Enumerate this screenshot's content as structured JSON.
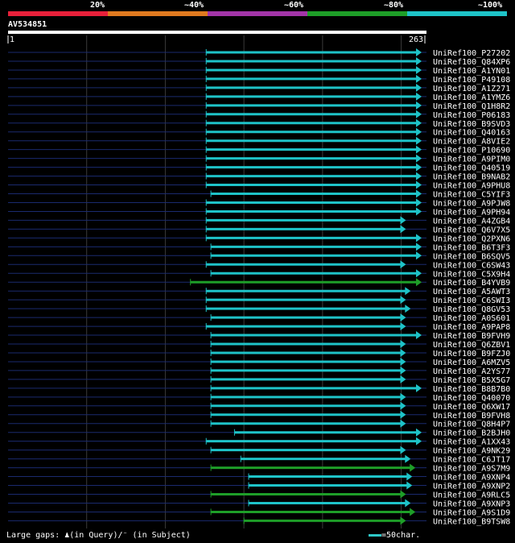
{
  "legend": {
    "colors": [
      "#e8203a",
      "#e07a1f",
      "#a335a8",
      "#1e9e28",
      "#1ec3c8"
    ],
    "labels": [
      "20%",
      "~40%",
      "~60%",
      "~80%",
      "~100%"
    ]
  },
  "query": {
    "id": "AV534851",
    "start_label": "1",
    "end_label": "263"
  },
  "footer": {
    "gaps_text": "Large gaps: ♟(in Query)/⁻ (in Subject)",
    "scale_text": "=50char."
  },
  "chart_data": {
    "type": "alignment",
    "query_length": 263,
    "hits": [
      {
        "name": "UniRef100_P27202",
        "start": 127,
        "end": 263,
        "identity": "~100%"
      },
      {
        "name": "UniRef100_Q84XP6",
        "start": 127,
        "end": 263,
        "identity": "~100%"
      },
      {
        "name": "UniRef100_A1YN01",
        "start": 127,
        "end": 263,
        "identity": "~100%"
      },
      {
        "name": "UniRef100_P49108",
        "start": 127,
        "end": 263,
        "identity": "~100%"
      },
      {
        "name": "UniRef100_A1Z271",
        "start": 127,
        "end": 263,
        "identity": "~100%"
      },
      {
        "name": "UniRef100_A1YMZ6",
        "start": 127,
        "end": 263,
        "identity": "~100%"
      },
      {
        "name": "UniRef100_Q1H8R2",
        "start": 127,
        "end": 263,
        "identity": "~100%"
      },
      {
        "name": "UniRef100_P06183",
        "start": 127,
        "end": 263,
        "identity": "~100%"
      },
      {
        "name": "UniRef100_B9SVD3",
        "start": 127,
        "end": 263,
        "identity": "~100%"
      },
      {
        "name": "UniRef100_Q40163",
        "start": 127,
        "end": 263,
        "identity": "~100%"
      },
      {
        "name": "UniRef100_A8VIE2",
        "start": 127,
        "end": 263,
        "identity": "~100%"
      },
      {
        "name": "UniRef100_P10690",
        "start": 127,
        "end": 263,
        "identity": "~100%"
      },
      {
        "name": "UniRef100_A9PIM0",
        "start": 127,
        "end": 263,
        "identity": "~100%"
      },
      {
        "name": "UniRef100_Q40519",
        "start": 127,
        "end": 263,
        "identity": "~100%"
      },
      {
        "name": "UniRef100_B9NAB2",
        "start": 127,
        "end": 263,
        "identity": "~100%"
      },
      {
        "name": "UniRef100_A9PHU8",
        "start": 127,
        "end": 263,
        "identity": "~100%"
      },
      {
        "name": "UniRef100_C5YIF3",
        "start": 130,
        "end": 263,
        "identity": "~100%"
      },
      {
        "name": "UniRef100_A9PJW8",
        "start": 127,
        "end": 263,
        "identity": "~100%"
      },
      {
        "name": "UniRef100_A9PH94",
        "start": 127,
        "end": 263,
        "identity": "~100%"
      },
      {
        "name": "UniRef100_A4ZGB4",
        "start": 127,
        "end": 253,
        "identity": "~100%"
      },
      {
        "name": "UniRef100_Q6V7X5",
        "start": 127,
        "end": 253,
        "identity": "~100%"
      },
      {
        "name": "UniRef100_Q2PXN6",
        "start": 127,
        "end": 263,
        "identity": "~100%"
      },
      {
        "name": "UniRef100_B6T3F3",
        "start": 130,
        "end": 263,
        "identity": "~100%"
      },
      {
        "name": "UniRef100_B6SQV5",
        "start": 130,
        "end": 263,
        "identity": "~100%"
      },
      {
        "name": "UniRef100_C6SW43",
        "start": 127,
        "end": 253,
        "identity": "~100%"
      },
      {
        "name": "UniRef100_C5X9H4",
        "start": 130,
        "end": 263,
        "identity": "~100%"
      },
      {
        "name": "UniRef100_B4YVB9",
        "start": 117,
        "end": 263,
        "identity": "~80%"
      },
      {
        "name": "UniRef100_A5AWT3",
        "start": 127,
        "end": 256,
        "identity": "~100%"
      },
      {
        "name": "UniRef100_C6SWI3",
        "start": 127,
        "end": 253,
        "identity": "~100%"
      },
      {
        "name": "UniRef100_Q8GV53",
        "start": 127,
        "end": 256,
        "identity": "~100%"
      },
      {
        "name": "UniRef100_A0S601",
        "start": 130,
        "end": 253,
        "identity": "~100%"
      },
      {
        "name": "UniRef100_A9PAP8",
        "start": 127,
        "end": 253,
        "identity": "~100%"
      },
      {
        "name": "UniRef100_B9FVH9",
        "start": 130,
        "end": 263,
        "identity": "~100%"
      },
      {
        "name": "UniRef100_Q6ZBV1",
        "start": 130,
        "end": 253,
        "identity": "~100%"
      },
      {
        "name": "UniRef100_B9FZJ0",
        "start": 130,
        "end": 253,
        "identity": "~100%"
      },
      {
        "name": "UniRef100_A6MZV5",
        "start": 130,
        "end": 253,
        "identity": "~100%"
      },
      {
        "name": "UniRef100_A2YS77",
        "start": 130,
        "end": 253,
        "identity": "~100%"
      },
      {
        "name": "UniRef100_B5X5G7",
        "start": 130,
        "end": 253,
        "identity": "~100%"
      },
      {
        "name": "UniRef100_B8B7B0",
        "start": 130,
        "end": 263,
        "identity": "~100%"
      },
      {
        "name": "UniRef100_Q40070",
        "start": 130,
        "end": 253,
        "identity": "~100%"
      },
      {
        "name": "UniRef100_Q6XW17",
        "start": 130,
        "end": 253,
        "identity": "~100%"
      },
      {
        "name": "UniRef100_B9FVH8",
        "start": 130,
        "end": 253,
        "identity": "~100%"
      },
      {
        "name": "UniRef100_Q8H4P7",
        "start": 130,
        "end": 253,
        "identity": "~100%"
      },
      {
        "name": "UniRef100_B2BJH0",
        "start": 145,
        "end": 263,
        "identity": "~100%"
      },
      {
        "name": "UniRef100_A1XX43",
        "start": 127,
        "end": 263,
        "identity": "~100%"
      },
      {
        "name": "UniRef100_A9NK29",
        "start": 130,
        "end": 253,
        "identity": "~100%"
      },
      {
        "name": "UniRef100_C6JT17",
        "start": 149,
        "end": 256,
        "identity": "~100%"
      },
      {
        "name": "UniRef100_A9S7M9",
        "start": 130,
        "end": 259,
        "identity": "~80%"
      },
      {
        "name": "UniRef100_A9XNP4",
        "start": 154,
        "end": 257,
        "identity": "~100%"
      },
      {
        "name": "UniRef100_A9XNP2",
        "start": 154,
        "end": 257,
        "identity": "~100%"
      },
      {
        "name": "UniRef100_A9RLC5",
        "start": 130,
        "end": 253,
        "identity": "~80%"
      },
      {
        "name": "UniRef100_A9XNP3",
        "start": 154,
        "end": 256,
        "identity": "~100%"
      },
      {
        "name": "UniRef100_A9S1D9",
        "start": 130,
        "end": 259,
        "identity": "~80%"
      },
      {
        "name": "UniRef100_B9TSW8",
        "start": 151,
        "end": 253,
        "identity": "~80%"
      }
    ]
  }
}
